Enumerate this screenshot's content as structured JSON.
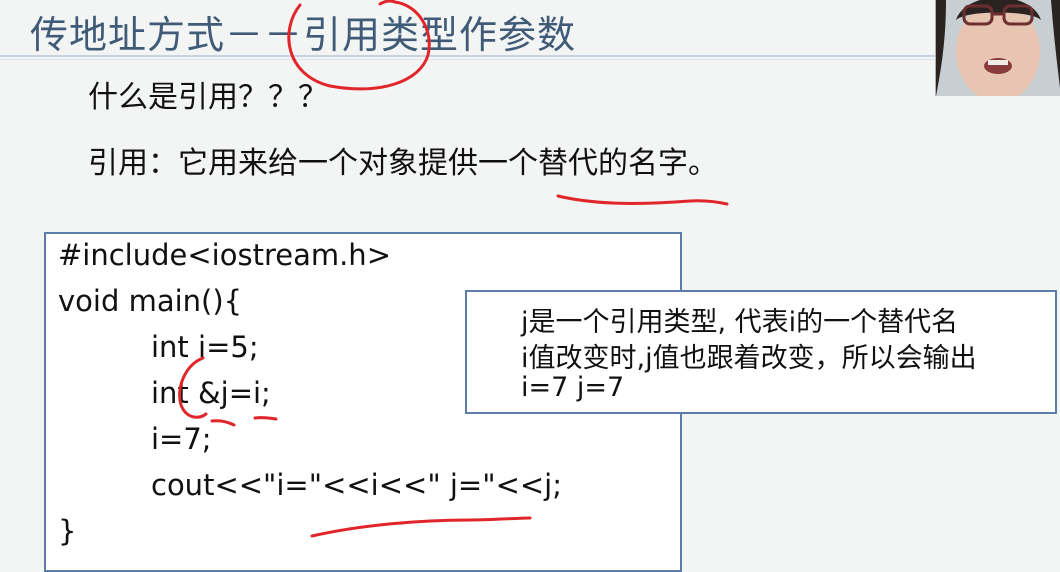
{
  "slide": {
    "title": "传地址方式－－引用类型作参数",
    "question": "什么是引用？？？",
    "definition": "引用：它用来给一个对象提供一个替代的名字。"
  },
  "code": {
    "lines": [
      "#include<iostream.h>",
      "void main(){",
      "int i=5;",
      "int &j=i;",
      "i=7;",
      "cout<<\"i=\"<<i<<\" j=\"<<j;",
      "}"
    ]
  },
  "callout": {
    "lines": [
      "j是一个引用类型, 代表i的一个替代名",
      "i值改变时,j值也跟着改变，所以会输出",
      "i=7 j=7"
    ]
  },
  "colors": {
    "title": "#3f5b78",
    "box_border": "#5b7da8",
    "annotation_ink": "#e0252b"
  }
}
